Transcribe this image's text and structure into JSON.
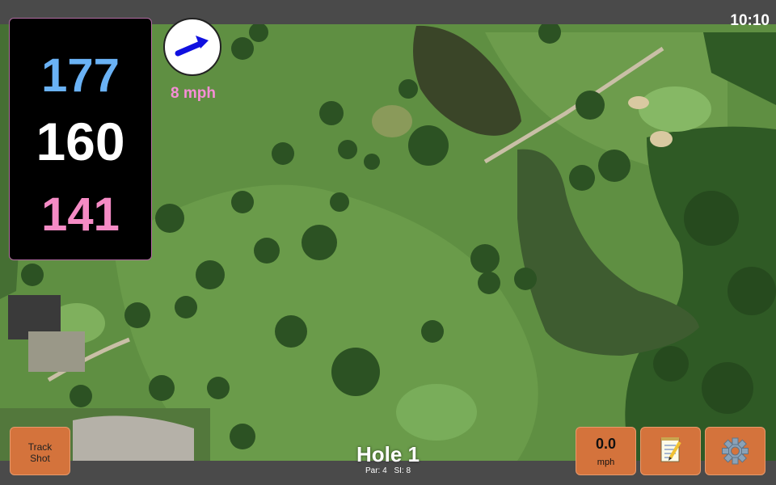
{
  "status_bar": {
    "time": "10:10"
  },
  "distances": {
    "back": "177",
    "middle": "160",
    "front": "141"
  },
  "wind": {
    "speed_label": "8 mph"
  },
  "hole": {
    "title": "Hole 1",
    "par_label": "Par: 4",
    "si_label": "SI: 8"
  },
  "buttons": {
    "track_shot_line1": "Track",
    "track_shot_line2": "Shot",
    "speed_value": "0.0",
    "speed_unit": "mph"
  },
  "colors": {
    "back_distance": "#6ab2f5",
    "middle_distance": "#ffffff",
    "front_distance": "#f58bc5",
    "wind_label": "#f78ed7",
    "button_bg": "#d4733c",
    "wind_arrow": "#1010e0"
  },
  "icons": {
    "wind": "wind-direction-arrow-icon",
    "notes": "notepad-icon",
    "settings": "gear-icon"
  }
}
